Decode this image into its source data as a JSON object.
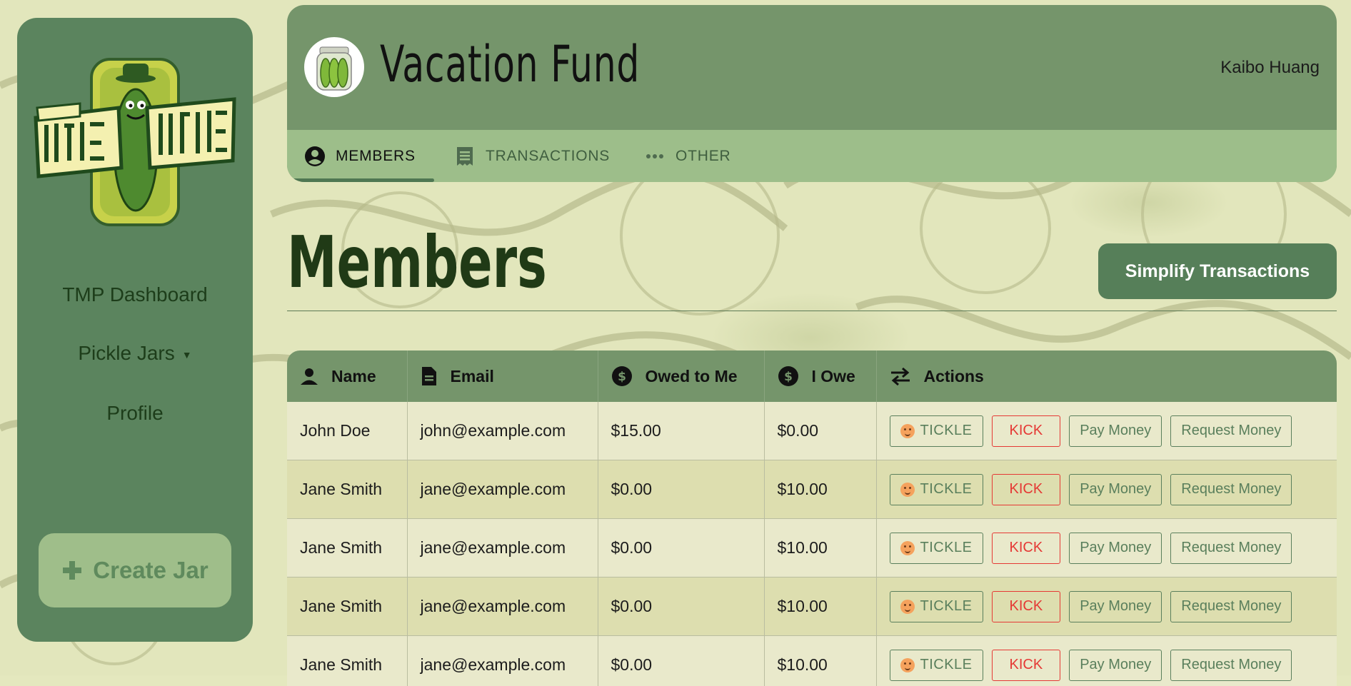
{
  "brand": {
    "logo_alt": "Tickle Mah Pickle"
  },
  "sidebar": {
    "items": [
      {
        "label": "TMP Dashboard"
      },
      {
        "label": "Pickle Jars"
      },
      {
        "label": "Profile"
      }
    ],
    "create_jar_label": "Create Jar"
  },
  "header": {
    "title": "Vacation Fund",
    "user": "Kaibo Huang"
  },
  "tabs": [
    {
      "label": "MEMBERS",
      "active": true
    },
    {
      "label": "TRANSACTIONS",
      "active": false
    },
    {
      "label": "OTHER",
      "active": false
    }
  ],
  "page": {
    "title": "Members",
    "simplify_label": "Simplify Transactions"
  },
  "table": {
    "columns": [
      "Name",
      "Email",
      "Owed to Me",
      "I Owe",
      "Actions"
    ],
    "action_labels": {
      "tickle": "TICKLE",
      "kick": "KICK",
      "pay": "Pay Money",
      "request": "Request Money"
    },
    "rows": [
      {
        "name": "John Doe",
        "email": "john@example.com",
        "owed_to_me": "$15.00",
        "i_owe": "$0.00"
      },
      {
        "name": "Jane Smith",
        "email": "jane@example.com",
        "owed_to_me": "$0.00",
        "i_owe": "$10.00"
      },
      {
        "name": "Jane Smith",
        "email": "jane@example.com",
        "owed_to_me": "$0.00",
        "i_owe": "$10.00"
      },
      {
        "name": "Jane Smith",
        "email": "jane@example.com",
        "owed_to_me": "$0.00",
        "i_owe": "$10.00"
      },
      {
        "name": "Jane Smith",
        "email": "jane@example.com",
        "owed_to_me": "$0.00",
        "i_owe": "$10.00"
      }
    ]
  },
  "colors": {
    "sidebar": "#5b845e",
    "header": "#75956b",
    "tabs_bar": "#9dbe8a",
    "primary_button": "#567f59",
    "kick": "#e53935"
  }
}
